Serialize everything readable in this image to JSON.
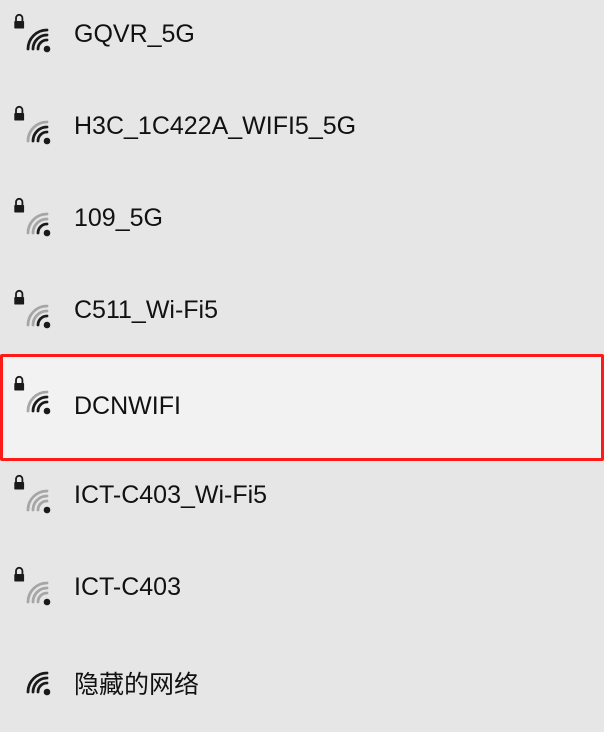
{
  "networks": [
    {
      "name": "GQVR_5G",
      "secured": true,
      "signal_bars": 4,
      "selected": false
    },
    {
      "name": "H3C_1C422A_WIFI5_5G",
      "secured": true,
      "signal_bars": 3,
      "selected": false
    },
    {
      "name": "109_5G",
      "secured": true,
      "signal_bars": 2,
      "selected": false
    },
    {
      "name": "C511_Wi-Fi5",
      "secured": true,
      "signal_bars": 2,
      "selected": false
    },
    {
      "name": "DCNWIFI",
      "secured": true,
      "signal_bars": 3,
      "selected": true
    },
    {
      "name": "ICT-C403_Wi-Fi5",
      "secured": true,
      "signal_bars": 1,
      "selected": false
    },
    {
      "name": "ICT-C403",
      "secured": true,
      "signal_bars": 1,
      "selected": false
    },
    {
      "name": "隐藏的网络",
      "secured": false,
      "signal_bars": 4,
      "selected": false
    }
  ],
  "colors": {
    "background": "#e6e6e6",
    "selected_background": "#f2f2f2",
    "selection_border": "#ff1a1a",
    "signal_active": "#1a1a1a",
    "signal_inactive": "#a6a6a6",
    "text": "#111111"
  },
  "icons": {
    "signal": "wifi-signal-icon",
    "lock": "lock-icon"
  }
}
